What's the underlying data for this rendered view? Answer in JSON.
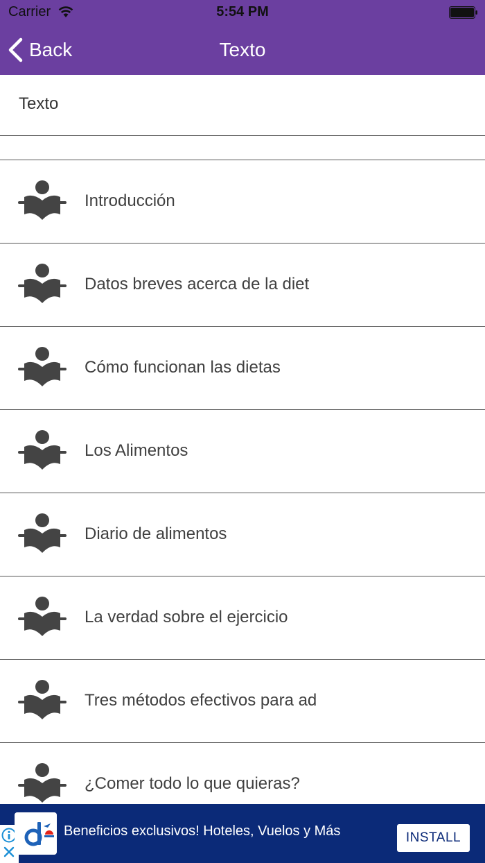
{
  "status_bar": {
    "carrier": "Carrier",
    "time": "5:54 PM"
  },
  "nav": {
    "back_label": "Back",
    "title": "Texto"
  },
  "section": {
    "header": "Texto"
  },
  "items": [
    {
      "label": "Introducción"
    },
    {
      "label": "Datos breves acerca de la diet"
    },
    {
      "label": "Cómo funcionan las dietas"
    },
    {
      "label": "Los Alimentos"
    },
    {
      "label": "Diario de alimentos"
    },
    {
      "label": "La verdad sobre el ejercicio"
    },
    {
      "label": "Tres métodos efectivos para ad"
    },
    {
      "label": "¿Comer todo lo que quieras?"
    }
  ],
  "ad": {
    "text": "Beneficios exclusivos! Hoteles, Vuelos y Más",
    "install_label": "INSTALL"
  },
  "colors": {
    "nav_background": "#6b3fa0",
    "ad_background": "#0b2a78",
    "icon": "#444444"
  },
  "icons": {
    "list_item": "reader-icon",
    "back": "chevron-left-icon"
  }
}
